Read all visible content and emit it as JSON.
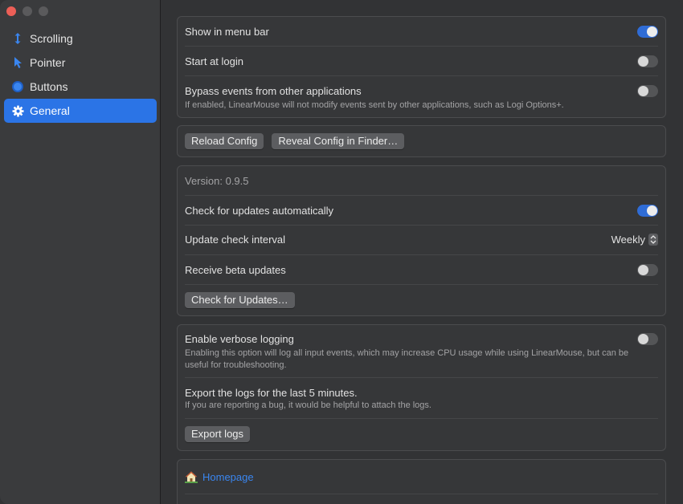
{
  "sidebar": {
    "items": [
      {
        "label": "Scrolling",
        "icon": "scroll-arrows-icon",
        "active": false
      },
      {
        "label": "Pointer",
        "icon": "pointer-arrow-icon",
        "active": false
      },
      {
        "label": "Buttons",
        "icon": "circle-button-icon",
        "active": false
      },
      {
        "label": "General",
        "icon": "gear-icon",
        "active": true
      }
    ]
  },
  "general": {
    "show_in_menu_bar": {
      "label": "Show in menu bar",
      "on": true
    },
    "start_at_login": {
      "label": "Start at login",
      "on": false
    },
    "bypass_events": {
      "label": "Bypass events from other applications",
      "description": "If enabled, LinearMouse will not modify events sent by other applications, such as Logi Options+.",
      "on": false
    }
  },
  "config": {
    "reload_label": "Reload Config",
    "reveal_label": "Reveal Config in Finder…"
  },
  "updates": {
    "version": "Version: 0.9.5",
    "auto_check": {
      "label": "Check for updates automatically",
      "on": true
    },
    "interval": {
      "label": "Update check interval",
      "value": "Weekly"
    },
    "beta": {
      "label": "Receive beta updates",
      "on": false
    },
    "check_button": "Check for Updates…"
  },
  "logging": {
    "verbose": {
      "label": "Enable verbose logging",
      "description": "Enabling this option will log all input events, which may increase CPU usage while using LinearMouse, but can be useful for troubleshooting.",
      "on": false
    },
    "export": {
      "label": "Export the logs for the last 5 minutes.",
      "description": "If you are reporting a bug, it would be helpful to attach the logs.",
      "button": "Export logs"
    }
  },
  "links": {
    "homepage": {
      "label": "Homepage",
      "icon": "house-icon"
    }
  },
  "colors": {
    "accent": "#2b74e6",
    "toggle_on": "#2f6cd6",
    "link": "#3a86f0",
    "close": "#ec5f57"
  }
}
